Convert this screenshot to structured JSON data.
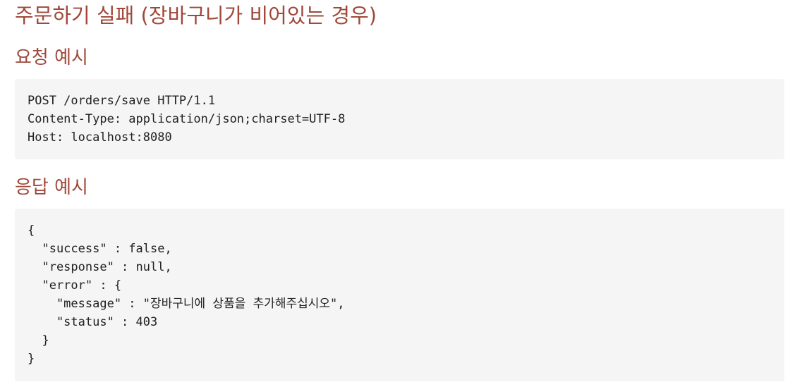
{
  "section": {
    "title": "주문하기 실패 (장바구니가 비어있는 경우)"
  },
  "request": {
    "heading": "요청 예시",
    "code": "POST /orders/save HTTP/1.1\nContent-Type: application/json;charset=UTF-8\nHost: localhost:8080"
  },
  "response": {
    "heading": "응답 예시",
    "code": "{\n  \"success\" : false,\n  \"response\" : null,\n  \"error\" : {\n    \"message\" : \"장바구니에 상품을 추가해주십시오\",\n    \"status\" : 403\n  }\n}"
  },
  "colors": {
    "heading": "#a0483a",
    "code_background": "#f5f5f5",
    "code_text": "#222222"
  }
}
